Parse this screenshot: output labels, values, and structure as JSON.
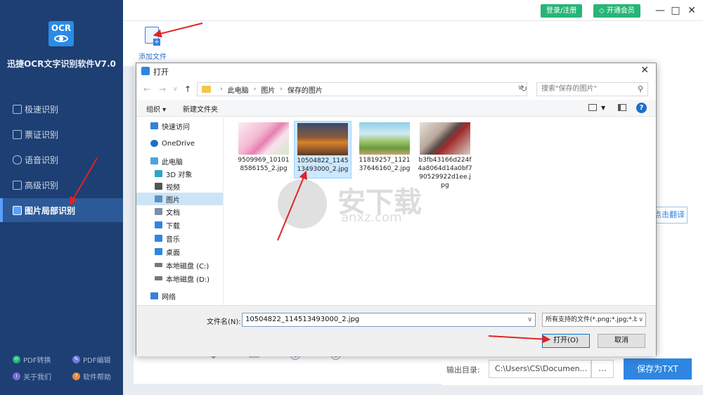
{
  "app": {
    "logo_text": "OCR",
    "title": "迅捷OCR文字识别软件V7.0"
  },
  "sidebar": {
    "items": [
      {
        "label": "极速识别"
      },
      {
        "label": "票证识别"
      },
      {
        "label": "语音识别"
      },
      {
        "label": "高级识别"
      },
      {
        "label": "图片局部识别",
        "active": true
      }
    ],
    "footer": [
      {
        "label": "PDF转换"
      },
      {
        "label": "PDF编辑"
      },
      {
        "label": "关于我们"
      },
      {
        "label": "软件帮助"
      }
    ]
  },
  "topbar": {
    "login": "登录/注册",
    "vip": "开通会员"
  },
  "toolbar": {
    "add_file": "添加文件"
  },
  "main": {
    "translate": "点击翻译",
    "output_label": "输出目录:",
    "output_path": "C:\\Users\\CS\\Documen...",
    "browse": "...",
    "save": "保存为TXT"
  },
  "dialog": {
    "title": "打开",
    "breadcrumb": [
      "此电脑",
      "图片",
      "保存的图片"
    ],
    "search_placeholder": "搜索\"保存的图片\"",
    "organize": "组织 ▾",
    "new_folder": "新建文件夹",
    "tree": [
      {
        "label": "快速访问",
        "color": "#3a7fd8"
      },
      {
        "label": "OneDrive",
        "color": "#1e6fc9"
      },
      {
        "label": "此电脑",
        "color": "#4aa3df"
      },
      {
        "label": "3D 对象",
        "color": "#2aa6c8"
      },
      {
        "label": "视频",
        "color": "#555555"
      },
      {
        "label": "图片",
        "color": "#5b8fc9",
        "selected": true
      },
      {
        "label": "文档",
        "color": "#7a8fa8"
      },
      {
        "label": "下载",
        "color": "#2f86e0"
      },
      {
        "label": "音乐",
        "color": "#2f86e0"
      },
      {
        "label": "桌面",
        "color": "#2f86e0"
      },
      {
        "label": "本地磁盘 (C:)",
        "color": "#777777"
      },
      {
        "label": "本地磁盘 (D:)",
        "color": "#777777"
      },
      {
        "label": "网络",
        "color": "#3a7fd8"
      }
    ],
    "files": [
      {
        "name": "9509969_101018586155_2.jpg"
      },
      {
        "name": "10504822_114513493000_2.jpg",
        "selected": true
      },
      {
        "name": "11819257_112137646160_2.jpg"
      },
      {
        "name": "b3fb43166d224f4a8064d14a0bf790529922d1ee.jpg"
      }
    ],
    "filename_label": "文件名(N):",
    "filename_value": "10504822_114513493000_2.jpg",
    "filetype": "所有支持的文件(*.png;*.jpg;*.b",
    "open": "打开(O)",
    "cancel": "取消"
  },
  "watermark": {
    "text": "安下载",
    "sub": "anxz.com"
  }
}
